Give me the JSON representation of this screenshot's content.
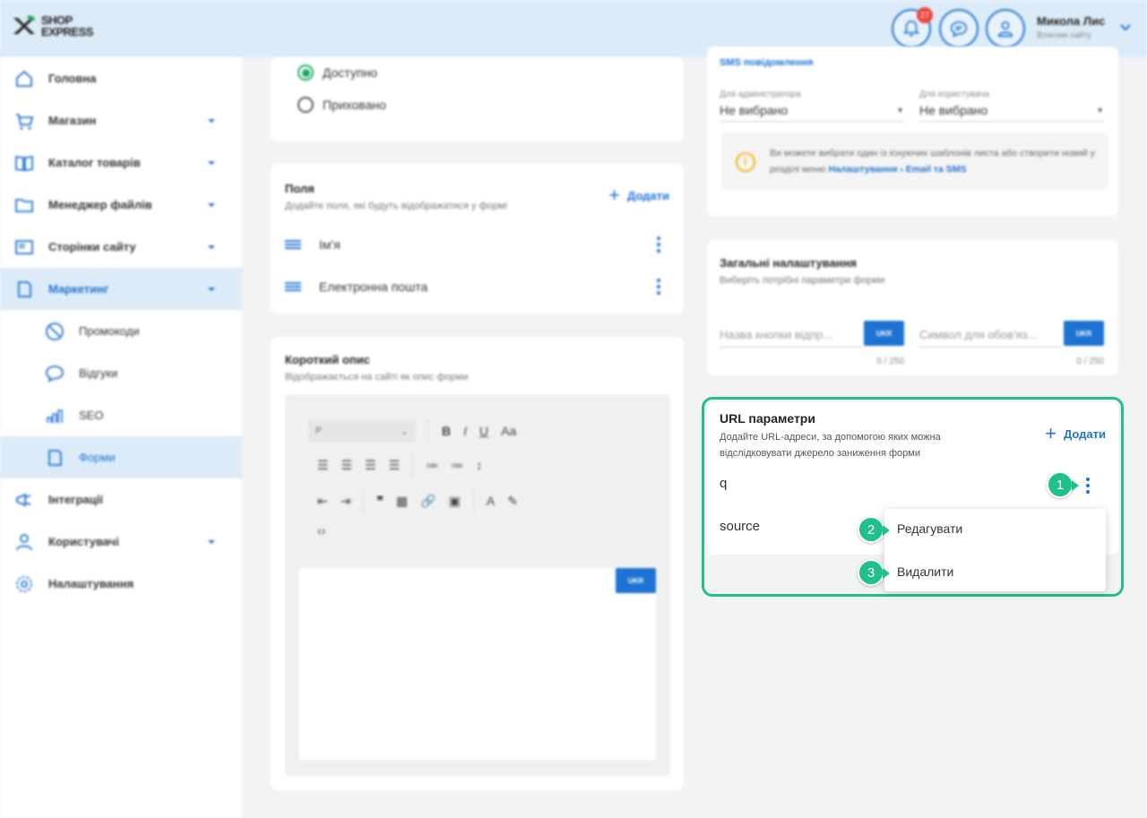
{
  "header": {
    "logo_line1": "SHOP",
    "logo_line2": "EXPRESS",
    "notifications_count": "27",
    "user_name": "Микола Лис",
    "user_role": "Власник сайту"
  },
  "sidebar": {
    "items": [
      {
        "label": "Головна",
        "icon": "home-icon"
      },
      {
        "label": "Магазин",
        "icon": "cart-icon"
      },
      {
        "label": "Каталог товарів",
        "icon": "book-icon"
      },
      {
        "label": "Менеджер файлів",
        "icon": "folder-icon"
      },
      {
        "label": "Сторінки сайту",
        "icon": "pages-icon"
      },
      {
        "label": "Маркетинг",
        "icon": "marketing-icon"
      },
      {
        "label": "Промокоди",
        "icon": "promo-icon"
      },
      {
        "label": "Відгуки",
        "icon": "reviews-icon"
      },
      {
        "label": "SEO",
        "icon": "seo-icon"
      },
      {
        "label": "Форми",
        "icon": "forms-icon"
      },
      {
        "label": "Інтеграції",
        "icon": "integrations-icon"
      },
      {
        "label": "Користувачі",
        "icon": "users-icon"
      },
      {
        "label": "Налаштування",
        "icon": "settings-icon"
      }
    ]
  },
  "visibility": {
    "option_available": "Доступно",
    "option_hidden": "Приховано"
  },
  "fields": {
    "title": "Поля",
    "subtitle": "Додайте поля, які будуть відображатися у формі",
    "add_label": "Додати",
    "rows": [
      "Ім'я",
      "Електронна пошта"
    ]
  },
  "short_desc": {
    "title": "Короткий опис",
    "subtitle": "Відображається на сайті як опис форми",
    "paragraph_select": "P",
    "lang": "UKR"
  },
  "sms": {
    "title": "SMS повідомлення",
    "admin_label": "Для адміністратора",
    "admin_value": "Не вибрано",
    "user_label": "Для користувача",
    "user_value": "Не вибрано",
    "info_text": "Ви можете вибрати один із існуючих шаблонів листа або створити новий у розділі меню",
    "info_link": "Налаштування › Email та SMS"
  },
  "general": {
    "title": "Загальні налаштування",
    "subtitle": "Виберіть потрібні параметри форми",
    "button_name_placeholder": "Назва кнопки відпр...",
    "required_symbol_placeholder": "Символ для обов'яз...",
    "counter": "0 / 250",
    "lang": "UKR"
  },
  "url_params": {
    "title": "URL параметри",
    "subtitle": "Додайте URL-адреси, за допомогою яких можна відслідковувати джерело заниження форми",
    "add_label": "Додати",
    "rows": [
      "q",
      "source"
    ],
    "menu": {
      "edit": "Редагувати",
      "delete": "Видалити"
    }
  },
  "steps": [
    "1",
    "2",
    "3"
  ],
  "colors": {
    "accent": "#1e73d2",
    "highlight": "#20c08d",
    "header_bg": "#dcebf8"
  }
}
